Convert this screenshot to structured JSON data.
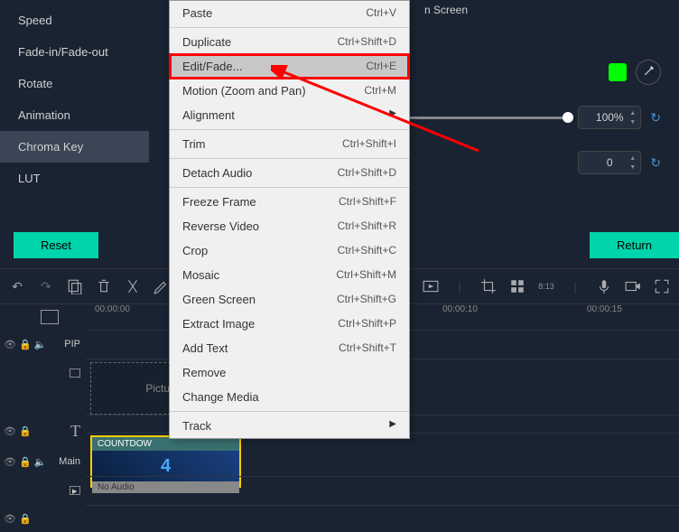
{
  "sidebar": {
    "items": [
      {
        "label": "Speed"
      },
      {
        "label": "Fade-in/Fade-out"
      },
      {
        "label": "Rotate"
      },
      {
        "label": "Animation"
      },
      {
        "label": "Chroma Key"
      },
      {
        "label": "LUT"
      }
    ]
  },
  "props": {
    "screen_label": "n Screen",
    "intensity_value": "100%",
    "offset_value": "0"
  },
  "buttons": {
    "reset": "Reset",
    "return": "Return"
  },
  "context_menu": [
    {
      "label": "Paste",
      "shortcut": "Ctrl+V"
    },
    {
      "divider": true
    },
    {
      "label": "Duplicate",
      "shortcut": "Ctrl+Shift+D"
    },
    {
      "label": "Edit/Fade...",
      "shortcut": "Ctrl+E",
      "highlight": true,
      "hover": true
    },
    {
      "label": "Motion (Zoom and Pan)",
      "shortcut": "Ctrl+M"
    },
    {
      "label": "Alignment",
      "submenu": true
    },
    {
      "divider": true
    },
    {
      "label": "Trim",
      "shortcut": "Ctrl+Shift+I"
    },
    {
      "divider": true
    },
    {
      "label": "Detach Audio",
      "shortcut": "Ctrl+Shift+D"
    },
    {
      "divider": true
    },
    {
      "label": "Freeze Frame",
      "shortcut": "Ctrl+Shift+F"
    },
    {
      "label": "Reverse Video",
      "shortcut": "Ctrl+Shift+R"
    },
    {
      "label": "Crop",
      "shortcut": "Ctrl+Shift+C"
    },
    {
      "label": "Mosaic",
      "shortcut": "Ctrl+Shift+M"
    },
    {
      "label": "Green Screen",
      "shortcut": "Ctrl+Shift+G"
    },
    {
      "label": "Extract Image",
      "shortcut": "Ctrl+Shift+P"
    },
    {
      "label": "Add Text",
      "shortcut": "Ctrl+Shift+T"
    },
    {
      "label": "Remove",
      "shortcut": ""
    },
    {
      "label": "Change Media",
      "shortcut": ""
    },
    {
      "divider": true
    },
    {
      "label": "Track",
      "submenu": true
    }
  ],
  "timeline": {
    "ticks": [
      "00:00:00",
      "00:00:10",
      "00:00:15"
    ],
    "pip_label": "PIP",
    "main_label": "Main",
    "placeholder": "Picture",
    "clip_name": "COUNTDOW",
    "clip_thumb_text": "4",
    "clip_footer": "No Audio"
  }
}
